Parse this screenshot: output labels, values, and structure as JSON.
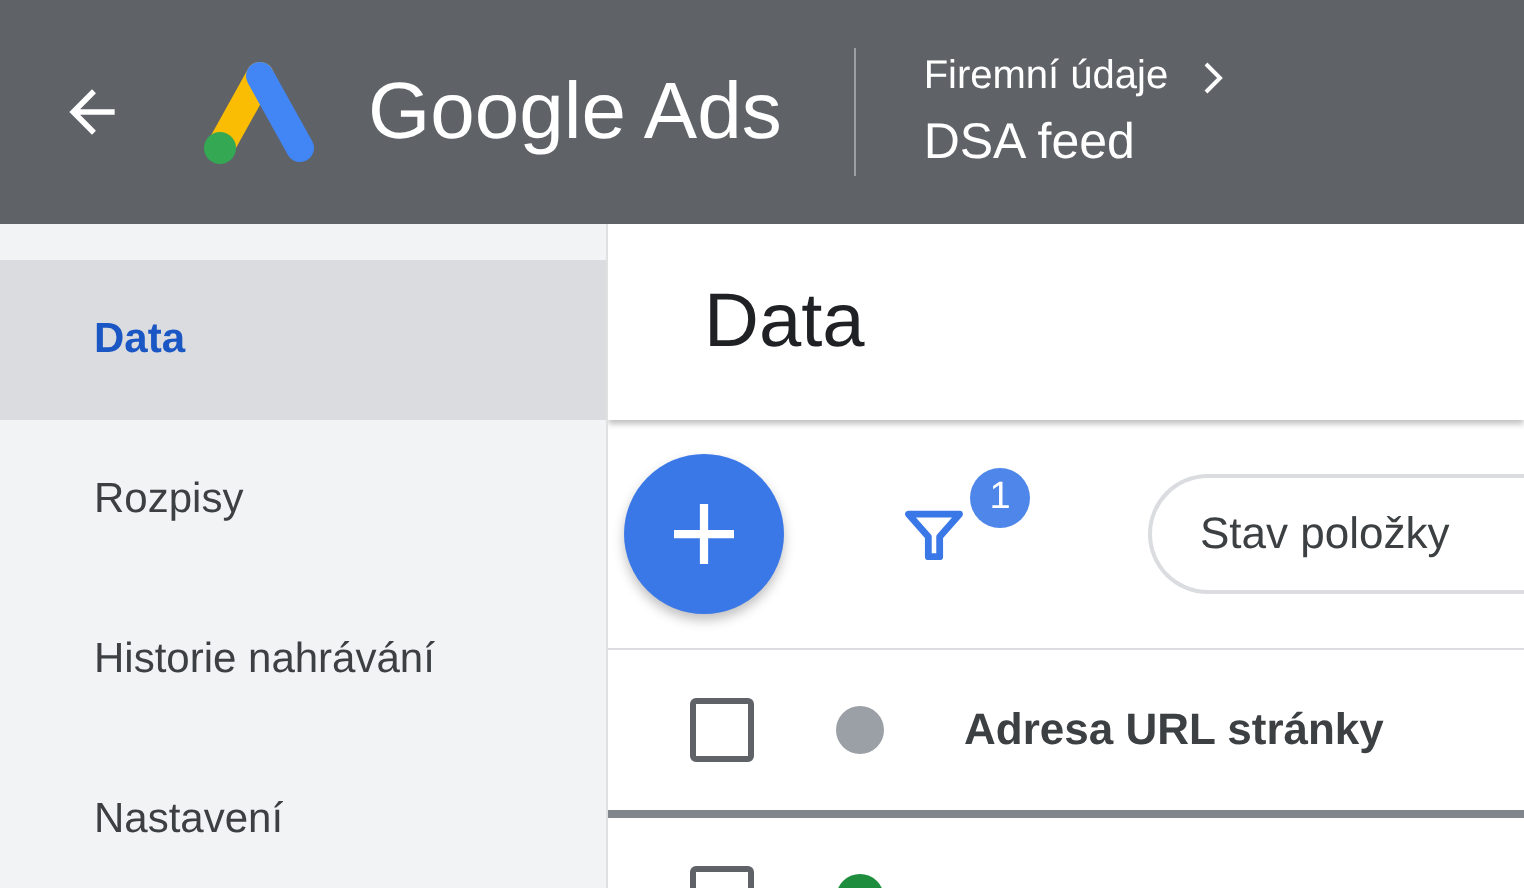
{
  "header": {
    "product": "Google Ads",
    "breadcrumb": "Firemní údaje",
    "page": "DSA feed"
  },
  "sidebar": {
    "items": [
      {
        "label": "Data",
        "selected": true
      },
      {
        "label": "Rozpisy",
        "selected": false
      },
      {
        "label": "Historie nahrávání",
        "selected": false
      },
      {
        "label": "Nastavení",
        "selected": false
      }
    ]
  },
  "main": {
    "title": "Data",
    "filter_count": "1",
    "chips": [
      "Stav položky"
    ]
  },
  "table": {
    "header": {
      "checked": false,
      "color": "#9aa0a6",
      "label": "Adresa URL stránky"
    },
    "rows": [
      {
        "checked": false,
        "color": "#1e8e3e"
      }
    ]
  }
}
